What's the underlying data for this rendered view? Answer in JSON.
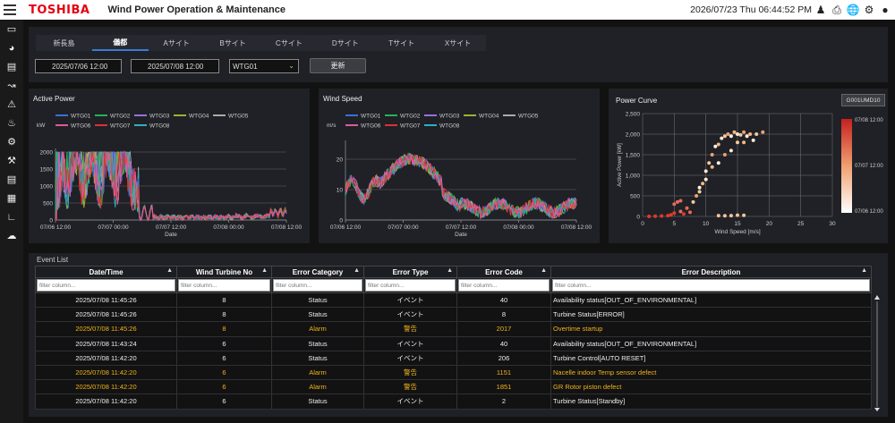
{
  "header": {
    "logo": "TOSHIBA",
    "title": "Wind Power Operation & Maintenance",
    "datetime": "2026/07/23 Thu 06:44:52 PM"
  },
  "tabs": [
    "新長島",
    "儀都",
    "Aサイト",
    "Bサイト",
    "Cサイト",
    "Dサイト",
    "Tサイト",
    "Xサイト"
  ],
  "active_tab": 1,
  "filters": {
    "start": "2025/07/06  12:00",
    "end": "2025/07/08  12:00",
    "turbine": "WTG01",
    "refresh_label": "更新"
  },
  "active_power": {
    "title": "Active Power",
    "unit": "kW",
    "legend": [
      "WTG01",
      "WTG02",
      "WTG03",
      "WTG04",
      "WTG05",
      "WTG06",
      "WTG07",
      "WTG08"
    ],
    "yticks": [
      "0",
      "500",
      "1000",
      "1500",
      "2000"
    ],
    "xticks": [
      "07/06 12:00",
      "07/07 00:00",
      "07/07 12:00",
      "07/08 00:00",
      "07/08 12:00"
    ],
    "xlabel": "Date"
  },
  "wind_speed": {
    "title": "Wind Speed",
    "unit": "m/s",
    "legend": [
      "WTG01",
      "WTG02",
      "WTG03",
      "WTG04",
      "WTG05",
      "WTG06",
      "WTG07",
      "WTG08"
    ],
    "yticks": [
      "0",
      "10",
      "20"
    ],
    "xticks": [
      "07/06 12:00",
      "07/07 00:00",
      "07/07 12:00",
      "07/08 00:00",
      "07/08 12:00"
    ],
    "xlabel": "Date"
  },
  "power_curve": {
    "title": "Power Curve",
    "device_button": "G001UMD10",
    "ylabel": "Active Power [kW]",
    "xlabel": "Wind Speed [m/s]",
    "yticks": [
      "0",
      "500",
      "1,000",
      "1,500",
      "2,000",
      "2,500"
    ],
    "xticks": [
      "0",
      "5",
      "10",
      "15",
      "20",
      "25",
      "30"
    ],
    "colorbar": [
      "07/08 12:00",
      "07/07 12:00",
      "07/06 12:00"
    ]
  },
  "chart_data": [
    {
      "type": "line",
      "title": "Active Power",
      "ylabel": "kW",
      "xlabel": "Date",
      "ylim": [
        0,
        2000
      ],
      "series": [
        {
          "name": "WTG01",
          "values": [
            1950,
            1800,
            600,
            1900,
            1700,
            1950,
            1900,
            1600,
            200,
            80,
            50,
            60,
            40,
            80,
            60,
            50,
            120
          ]
        },
        {
          "name": "WTG02",
          "values": [
            1900,
            1600,
            900,
            1850,
            1500,
            1900,
            1950,
            1800,
            300,
            100,
            60,
            80,
            60,
            70,
            50,
            40,
            100
          ]
        },
        {
          "name": "WTG06",
          "values": [
            2000,
            1700,
            500,
            1950,
            1800,
            2000,
            1950,
            1700,
            250,
            120,
            60,
            70,
            50,
            90,
            40,
            60,
            200
          ]
        }
      ]
    },
    {
      "type": "line",
      "title": "Wind Speed",
      "ylabel": "m/s",
      "xlabel": "Date",
      "ylim": [
        0,
        25
      ],
      "series": [
        {
          "name": "WTG01",
          "values": [
            9,
            12,
            8,
            13,
            12,
            16,
            18,
            19,
            17,
            9,
            5,
            4,
            3,
            4,
            5,
            4,
            3,
            4,
            5,
            6
          ]
        },
        {
          "name": "WTG06",
          "values": [
            10,
            13,
            9,
            12,
            14,
            17,
            19,
            20,
            16,
            8,
            5,
            4,
            3,
            5,
            4,
            3,
            4,
            5,
            4,
            6
          ]
        }
      ]
    },
    {
      "type": "scatter",
      "title": "Power Curve",
      "xlabel": "Wind Speed [m/s]",
      "ylabel": "Active Power [kW]",
      "xlim": [
        0,
        30
      ],
      "ylim": [
        0,
        2500
      ],
      "points": [
        [
          1,
          0
        ],
        [
          2,
          5
        ],
        [
          3,
          10
        ],
        [
          4,
          20
        ],
        [
          4.5,
          40
        ],
        [
          5,
          80
        ],
        [
          5,
          300
        ],
        [
          5.5,
          350
        ],
        [
          6,
          380
        ],
        [
          6,
          120
        ],
        [
          7,
          200
        ],
        [
          8,
          350
        ],
        [
          8.5,
          500
        ],
        [
          9,
          700
        ],
        [
          9.5,
          800
        ],
        [
          10,
          1100
        ],
        [
          10.5,
          1300
        ],
        [
          11,
          1500
        ],
        [
          11.5,
          1700
        ],
        [
          12,
          1750
        ],
        [
          12.5,
          1900
        ],
        [
          13,
          1950
        ],
        [
          13.5,
          2000
        ],
        [
          14,
          1950
        ],
        [
          14.5,
          2050
        ],
        [
          15,
          2000
        ],
        [
          15.5,
          1980
        ],
        [
          16,
          2050
        ],
        [
          16.5,
          1950
        ],
        [
          17,
          2000
        ],
        [
          14,
          1600
        ],
        [
          15,
          1800
        ],
        [
          13,
          1500
        ],
        [
          12,
          1300
        ],
        [
          11,
          1200
        ],
        [
          10,
          900
        ],
        [
          9,
          600
        ],
        [
          12,
          20
        ],
        [
          13,
          15
        ],
        [
          14,
          20
        ],
        [
          15,
          30
        ],
        [
          16,
          25
        ],
        [
          6.5,
          60
        ],
        [
          7.5,
          100
        ],
        [
          16,
          1800
        ],
        [
          17.5,
          1850
        ],
        [
          18,
          2000
        ],
        [
          19,
          2050
        ]
      ]
    }
  ],
  "events": {
    "title": "Event List",
    "columns": [
      "Date/Time",
      "Wind Turbine No",
      "Error Category",
      "Error Type",
      "Error Code",
      "Error Description"
    ],
    "filter_placeholder": "filter column...",
    "rows": [
      {
        "dt": "2025/07/08 11:45:26",
        "no": "8",
        "cat": "Status",
        "type": "イベント",
        "code": "40",
        "desc": "Availability status[OUT_OF_ENVIRONMENTAL]",
        "alarm": false
      },
      {
        "dt": "2025/07/08 11:45:26",
        "no": "8",
        "cat": "Status",
        "type": "イベント",
        "code": "8",
        "desc": "Turbine Status[ERROR]",
        "alarm": false
      },
      {
        "dt": "2025/07/08 11:45:26",
        "no": "8",
        "cat": "Alarm",
        "type": "警告",
        "code": "2017",
        "desc": "Overtime startup",
        "alarm": true
      },
      {
        "dt": "2025/07/08 11:43:24",
        "no": "6",
        "cat": "Status",
        "type": "イベント",
        "code": "40",
        "desc": "Availability status[OUT_OF_ENVIRONMENTAL]",
        "alarm": false
      },
      {
        "dt": "2025/07/08 11:42:20",
        "no": "6",
        "cat": "Status",
        "type": "イベント",
        "code": "206",
        "desc": "Turbine Control[AUTO RESET]",
        "alarm": false
      },
      {
        "dt": "2025/07/08 11:42:20",
        "no": "6",
        "cat": "Alarm",
        "type": "警告",
        "code": "1151",
        "desc": "Nacelle indoor Temp sensor defect",
        "alarm": true
      },
      {
        "dt": "2025/07/08 11:42:20",
        "no": "6",
        "cat": "Alarm",
        "type": "警告",
        "code": "1851",
        "desc": "GR Rotor piston defect",
        "alarm": true
      },
      {
        "dt": "2025/07/08 11:42:20",
        "no": "6",
        "cat": "Status",
        "type": "イベント",
        "code": "2",
        "desc": "Turbine Status[Standby]",
        "alarm": false
      }
    ]
  },
  "colors": {
    "wtg01": "#3a6fd8",
    "wtg02": "#2bb05a",
    "wtg03": "#9b6fe0",
    "wtg04": "#a0b030",
    "wtg05": "#aaaaaa",
    "wtg06": "#e05a9a",
    "wtg07": "#e03030",
    "wtg08": "#30b0c0",
    "alarm": "#f0b31c"
  }
}
